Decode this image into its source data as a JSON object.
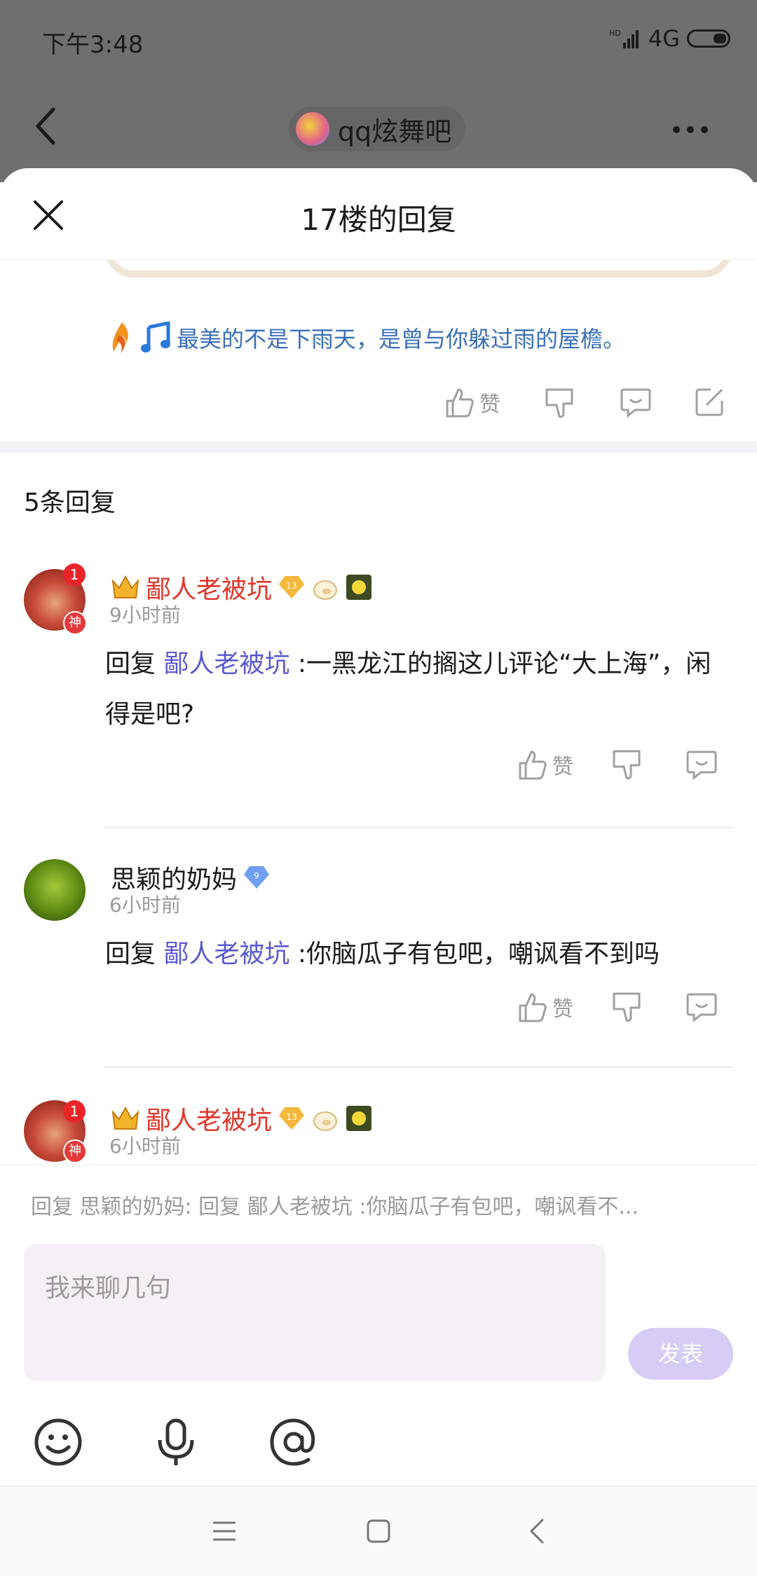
{
  "status_bar": {
    "time": "下午3:48",
    "network": "4G"
  },
  "top_nav": {
    "forum_name": "qq炫舞吧"
  },
  "sheet": {
    "title": "17楼的回复"
  },
  "post": {
    "signature": "最美的不是下雨天，是曾与你躲过雨的屋檐。",
    "like_label": "赞"
  },
  "reply_count_label": "5条回复",
  "replies": [
    {
      "avatar_badge": "1",
      "avatar_tag": "神",
      "username": "鄙人老被坑",
      "level": "13",
      "time": "9小时前",
      "prefix": "回复 ",
      "mention": "鄙人老被坑",
      "text": " :一黑龙江的搁这儿评论“大上海”，闲得是吧?",
      "like_label": "赞"
    },
    {
      "username": "思颖的奶妈",
      "level": "9",
      "time": "6小时前",
      "prefix": "回复 ",
      "mention": "鄙人老被坑",
      "text": " :你脑瓜子有包吧，嘲讽看不到吗",
      "like_label": "赞"
    },
    {
      "avatar_badge": "1",
      "avatar_tag": "神",
      "username": "鄙人老被坑",
      "level": "13",
      "time": "6小时前"
    }
  ],
  "composer": {
    "quote": "回复 思颖的奶妈: 回复 鄙人老被坑 :你脑瓜子有包吧，嘲讽看不...",
    "placeholder": "我来聊几句",
    "send_label": "发表"
  },
  "colors": {
    "accent": "#5a5ad0",
    "username_red": "#e0362a",
    "send_disabled": "#d6ccf5"
  }
}
